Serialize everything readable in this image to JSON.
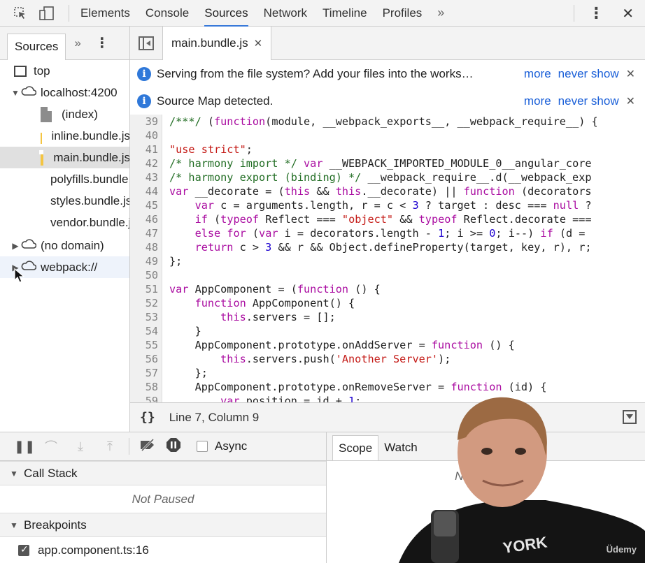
{
  "toolbar": {
    "tabs": [
      "Elements",
      "Console",
      "Sources",
      "Network",
      "Timeline",
      "Profiles"
    ],
    "active_tab": "Sources",
    "more_glyph": "»",
    "icons": [
      "inspect-icon",
      "device-mode-icon",
      "kebab-menu-icon",
      "close-icon"
    ]
  },
  "navigator": {
    "tab_label": "Sources",
    "more_glyph": "»",
    "tree": [
      {
        "label": "top",
        "type": "frame",
        "indent": 0
      },
      {
        "label": "localhost:4200",
        "type": "origin",
        "expanded": true
      },
      {
        "label": "(index)",
        "type": "file",
        "color": "#8c8c8c"
      },
      {
        "label": "inline.bundle.js",
        "type": "file",
        "color": "#f4c542"
      },
      {
        "label": "main.bundle.js",
        "type": "file",
        "color": "#f4c542",
        "selected": true
      },
      {
        "label": "polyfills.bundle.js",
        "type": "file",
        "color": "#f4c542"
      },
      {
        "label": "styles.bundle.js",
        "type": "file",
        "color": "#f4c542"
      },
      {
        "label": "vendor.bundle.js",
        "type": "file",
        "color": "#f4c542"
      },
      {
        "label": "(no domain)",
        "type": "origin",
        "expanded": false
      },
      {
        "label": "webpack://",
        "type": "origin",
        "expanded": false
      }
    ]
  },
  "editor": {
    "file_tab": "main.bundle.js",
    "infobars": [
      {
        "text": "Serving from the file system? Add your files into the works…",
        "more": "more",
        "never": "never show"
      },
      {
        "text": "Source Map detected.",
        "more": "more",
        "never": "never show"
      }
    ],
    "lines": [
      {
        "n": "39",
        "code": "/***/ (function(module, __webpack_exports__, __webpack_require__) {"
      },
      {
        "n": "40",
        "code": ""
      },
      {
        "n": "41",
        "code": "\"use strict\";"
      },
      {
        "n": "42",
        "code": "/* harmony import */ var __WEBPACK_IMPORTED_MODULE_0__angular_core"
      },
      {
        "n": "43",
        "code": "/* harmony export (binding) */ __webpack_require__.d(__webpack_exp"
      },
      {
        "n": "44",
        "code": "var __decorate = (this && this.__decorate) || function (decorators"
      },
      {
        "n": "45",
        "code": "    var c = arguments.length, r = c < 3 ? target : desc === null ?"
      },
      {
        "n": "46",
        "code": "    if (typeof Reflect === \"object\" && typeof Reflect.decorate ==="
      },
      {
        "n": "47",
        "code": "    else for (var i = decorators.length - 1; i >= 0; i--) if (d ="
      },
      {
        "n": "48",
        "code": "    return c > 3 && r && Object.defineProperty(target, key, r), r;"
      },
      {
        "n": "49",
        "code": "};"
      },
      {
        "n": "50",
        "code": ""
      },
      {
        "n": "51",
        "code": "var AppComponent = (function () {"
      },
      {
        "n": "52",
        "code": "    function AppComponent() {"
      },
      {
        "n": "53",
        "code": "        this.servers = [];"
      },
      {
        "n": "54",
        "code": "    }"
      },
      {
        "n": "55",
        "code": "    AppComponent.prototype.onAddServer = function () {"
      },
      {
        "n": "56",
        "code": "        this.servers.push('Another Server');"
      },
      {
        "n": "57",
        "code": "    };"
      },
      {
        "n": "58",
        "code": "    AppComponent.prototype.onRemoveServer = function (id) {"
      },
      {
        "n": "59",
        "code": "        var position = id + 1;"
      }
    ],
    "status": {
      "braces": "{}",
      "position": "Line 7, Column 9"
    }
  },
  "debugger": {
    "async_label": "Async",
    "call_stack_label": "Call Stack",
    "not_paused": "Not Paused",
    "breakpoints_label": "Breakpoints",
    "breakpoint": "app.component.ts:16",
    "scope_tabs": [
      "Scope",
      "Watch"
    ],
    "scope_not_paused": "Not Paused"
  },
  "watermark": "Üdemy",
  "colors": {
    "accent": "#3879d9",
    "link": "#1a5fd8",
    "file_js": "#f4c542",
    "file_doc": "#8c8c8c"
  }
}
